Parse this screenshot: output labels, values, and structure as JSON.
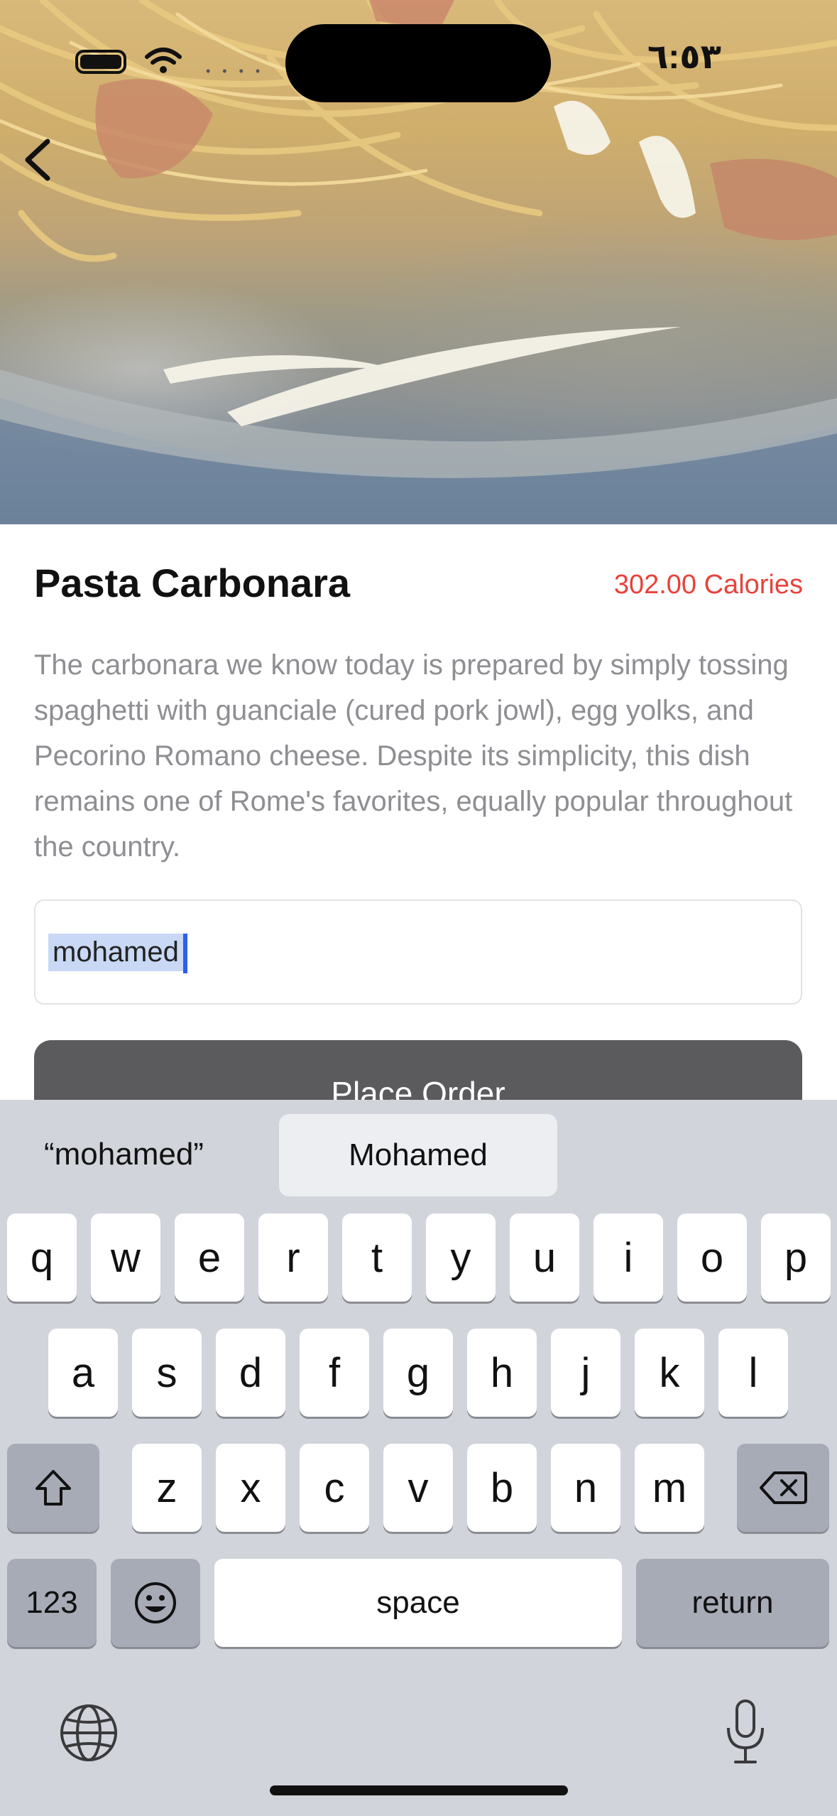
{
  "status_bar": {
    "time": "٦:٥٣"
  },
  "dish": {
    "name": "Pasta Carbonara",
    "calories": "302.00 Calories",
    "description": "The carbonara we know today is prepared by simply tossing spaghetti with guanciale (cured pork jowl), egg yolks, and Pecorino Romano cheese. Despite its simplicity, this dish remains one of Rome's favorites, equally popular throughout the country."
  },
  "name_input": {
    "value": "mohamed"
  },
  "order_button": {
    "label": "Place Order"
  },
  "keyboard": {
    "suggestions": [
      "“mohamed”",
      "Mohamed"
    ],
    "row1": [
      "q",
      "w",
      "e",
      "r",
      "t",
      "y",
      "u",
      "i",
      "o",
      "p"
    ],
    "row2": [
      "a",
      "s",
      "d",
      "f",
      "g",
      "h",
      "j",
      "k",
      "l"
    ],
    "row3": [
      "z",
      "x",
      "c",
      "v",
      "b",
      "n",
      "m"
    ],
    "numbers_label": "123",
    "space_label": "space",
    "return_label": "return"
  },
  "icons": [
    "back-chevron-icon",
    "battery-icon",
    "wifi-icon",
    "shift-icon",
    "delete-icon",
    "emoji-icon",
    "globe-icon",
    "microphone-icon"
  ]
}
